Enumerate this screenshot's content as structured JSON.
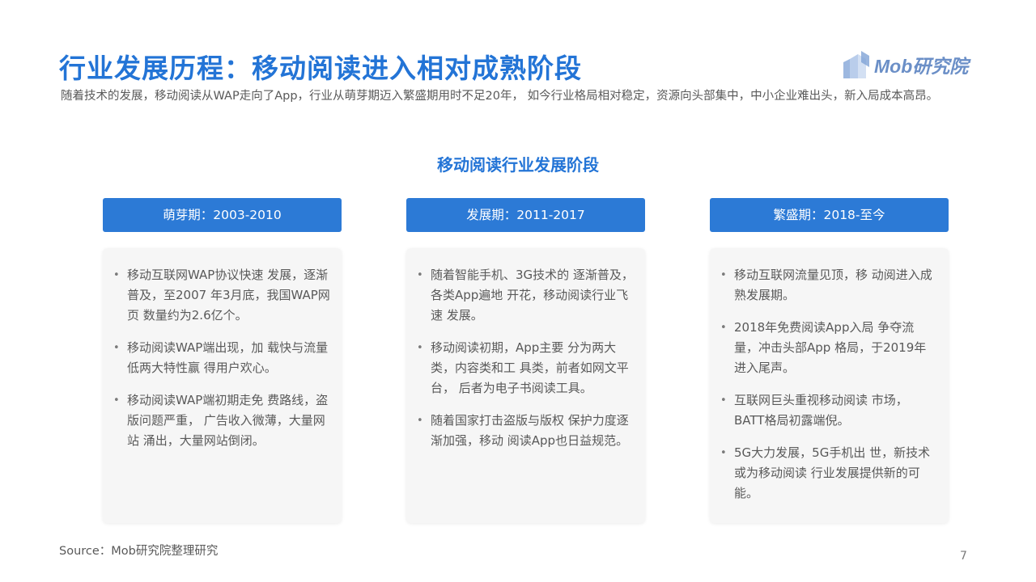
{
  "header": {
    "title": "行业发展历程：移动阅读进入相对成熟阶段",
    "subtitle": "随着技术的发展，移动阅读从WAP走向了App，行业从萌芽期迈入繁盛期用时不足20年， 如今行业格局相对稳定，资源向头部集中，中小企业难出头，新入局成本高昂。",
    "logo_text": "Mob研究院"
  },
  "chart_data": {
    "type": "table",
    "title": "移动阅读行业发展阶段",
    "stages": [
      {
        "label": "萌芽期：2003-2010",
        "bullets": [
          "移动互联网WAP协议快速 发展，逐渐普及，至2007 年3月底，我国WAP网页 数量约为2.6亿个。",
          "移动阅读WAP端出现，加 载快与流量低两大特性赢 得用户欢心。",
          "移动阅读WAP端初期走免 费路线，盗版问题严重，  广告收入微薄，大量网站 涌出，大量网站倒闭。"
        ]
      },
      {
        "label": "发展期：2011-2017",
        "bullets": [
          "随着智能手机、3G技术的 逐渐普及，各类App遍地 开花，移动阅读行业飞速 发展。",
          "移动阅读初期，App主要 分为两大类，内容类和工 具类，前者如网文平台， 后者为电子书阅读工具。",
          "随着国家打击盗版与版权 保护力度逐渐加强，移动 阅读App也日益规范。"
        ]
      },
      {
        "label": "繁盛期：2018-至今",
        "bullets": [
          "移动互联网流量见顶，移 动阅进入成熟发展期。",
          "2018年免费阅读App入局 争夺流量，冲击头部App 格局，于2019年进入尾声。",
          "互联网巨头重视移动阅读 市场，BATT格局初露端倪。",
          "5G大力发展，5G手机出 世，新技术或为移动阅读 行业发展提供新的可能。"
        ]
      }
    ]
  },
  "footer": {
    "source": "Source：Mob研究院整理研究",
    "page_number": "7"
  },
  "colors": {
    "accent": "#2374d6",
    "header_bg": "#2c7ad6",
    "card_bg": "#f6f6f6",
    "text": "#595959"
  },
  "icons": {
    "logo": "building-blocks-icon",
    "bullet": "bullet-dot-icon"
  }
}
